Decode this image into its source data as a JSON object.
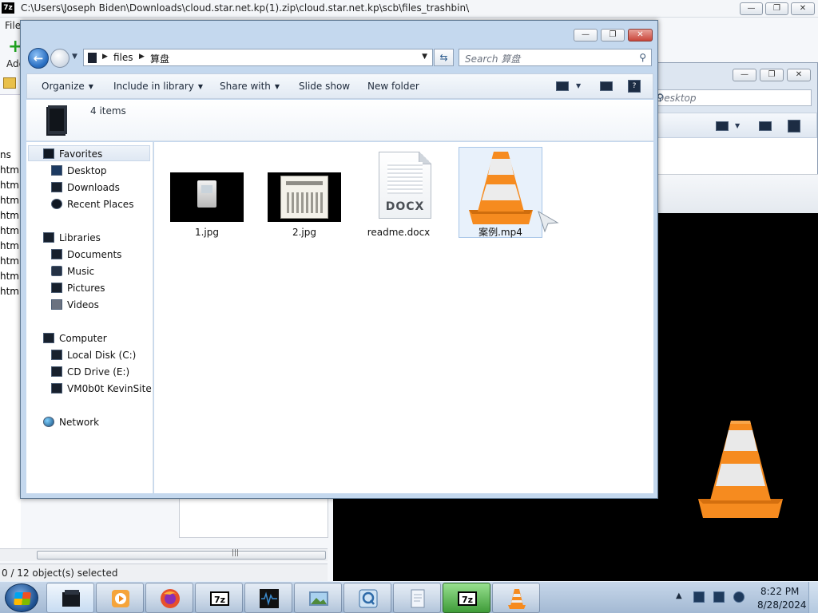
{
  "sevenzip": {
    "title": "C:\\Users\\Joseph Biden\\Downloads\\cloud.star.net.kp(1).zip\\cloud.star.net.kp\\scb\\files_trashbin\\",
    "menu_file": "File",
    "add_label": "Add",
    "list_rows": [
      "ns",
      "html",
      "html",
      "html",
      "html",
      "html",
      "html",
      "html",
      "html",
      "html"
    ],
    "status": "0 / 12 object(s) selected",
    "scroll_grip": "|||"
  },
  "explorer": {
    "breadcrumb": [
      "files",
      "算盘"
    ],
    "search_placeholder": "Search 算盘",
    "commands": {
      "organize": "Organize",
      "include_in_library": "Include in library",
      "share_with": "Share with",
      "slide_show": "Slide show",
      "new_folder": "New folder"
    },
    "items_count": "4 items",
    "nav": {
      "favorites": "Favorites",
      "desktop": "Desktop",
      "downloads": "Downloads",
      "recent_places": "Recent Places",
      "libraries": "Libraries",
      "documents": "Documents",
      "music": "Music",
      "pictures": "Pictures",
      "videos": "Videos",
      "computer": "Computer",
      "local_disk": "Local Disk (C:)",
      "cd_drive": "CD Drive (E:)",
      "network_drive": "VM0b0t KevinSite",
      "network": "Network"
    },
    "files": [
      {
        "name": "1.jpg",
        "type": "image"
      },
      {
        "name": "2.jpg",
        "type": "image"
      },
      {
        "name": "readme.docx",
        "type": "document",
        "badge": "DOCX"
      },
      {
        "name": "案例.mp4",
        "type": "video",
        "selected": true
      }
    ]
  },
  "explorer_back": {
    "search_placeholder": "Desktop"
  },
  "taskbar": {
    "time": "8:22 PM",
    "date": "8/28/2024",
    "apps": [
      "explorer",
      "vlc-media-player",
      "firefox",
      "7zip",
      "media-app",
      "photo-viewer",
      "quicktime",
      "notepad",
      "7zip",
      "vlc"
    ]
  },
  "colors": {
    "vlc_orange": "#f68b1f",
    "selection": "#e8f1fb",
    "window_frame": "#c4d8ee"
  }
}
